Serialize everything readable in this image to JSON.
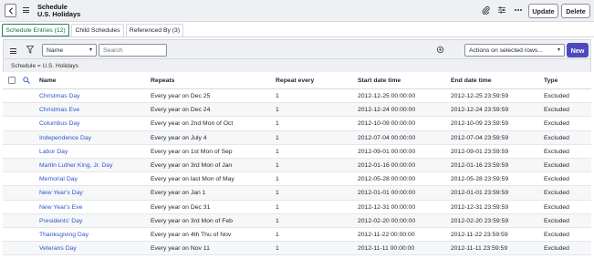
{
  "header": {
    "title": "Schedule",
    "subtitle": "U.S. Holidays",
    "update_label": "Update",
    "delete_label": "Delete",
    "icons": [
      "back-icon",
      "hamburger-icon",
      "attachment-icon",
      "settings-sliders-icon",
      "more-icon"
    ]
  },
  "tabs": [
    {
      "label": "Schedule Entries (12)",
      "active": true
    },
    {
      "label": "Child Schedules",
      "active": false
    },
    {
      "label": "Referenced By (3)",
      "active": false
    }
  ],
  "toolbar": {
    "field_select": "Name",
    "search_placeholder": "Search",
    "actions_select": "Actions on selected rows...",
    "new_label": "New"
  },
  "breadcrumb": "Schedule = U.S. Holidays",
  "table": {
    "columns": [
      "Name",
      "Repeats",
      "Repeat every",
      "Start date time",
      "End date time",
      "Type"
    ],
    "rows": [
      [
        "Christmas Day",
        "Every year on Dec 25",
        "1",
        "2012-12-25 00:00:00",
        "2012-12-25 23:59:59",
        "Excluded"
      ],
      [
        "Christmas Eve",
        "Every year on Dec 24",
        "1",
        "2012-12-24 00:00:00",
        "2012-12-24 23:59:59",
        "Excluded"
      ],
      [
        "Columbus Day",
        "Every year on 2nd Mon of Oct",
        "1",
        "2012-10-09 00:00:00",
        "2012-10-09 23:59:59",
        "Excluded"
      ],
      [
        "Independence Day",
        "Every year on July 4",
        "1",
        "2012-07-04 00:00:00",
        "2012-07-04 23:59:59",
        "Excluded"
      ],
      [
        "Labor Day",
        "Every year on 1st Mon of Sep",
        "1",
        "2012-09-01 00:00:00",
        "2012-09-01 23:59:59",
        "Excluded"
      ],
      [
        "Martin Luther King, Jr. Day",
        "Every year on 3rd Mon of Jan",
        "1",
        "2012-01-16 00:00:00",
        "2012-01-16 23:59:59",
        "Excluded"
      ],
      [
        "Memorial Day",
        "Every year on last Mon of May",
        "1",
        "2012-05-28 00:00:00",
        "2012-05-28 23:59:59",
        "Excluded"
      ],
      [
        "New Year's Day",
        "Every year on Jan 1",
        "1",
        "2012-01-01 00:00:00",
        "2012-01-01 23:59:59",
        "Excluded"
      ],
      [
        "New Year's Eve",
        "Every year on Dec 31",
        "1",
        "2012-12-31 00:00:00",
        "2012-12-31 23:59:59",
        "Excluded"
      ],
      [
        "Presidents' Day",
        "Every year on 3rd Mon of Feb",
        "1",
        "2012-02-20 00:00:00",
        "2012-02-20 23:59:59",
        "Excluded"
      ],
      [
        "Thanksgiving Day",
        "Every year on 4th Thu of Nov",
        "1",
        "2012-11-22 00:00:00",
        "2012-11-22 23:59:59",
        "Excluded"
      ],
      [
        "Veterans Day",
        "Every year on Nov 11",
        "1",
        "2012-11-11 00:00:00",
        "2012-11-11 23:59:59",
        "Excluded"
      ]
    ]
  }
}
